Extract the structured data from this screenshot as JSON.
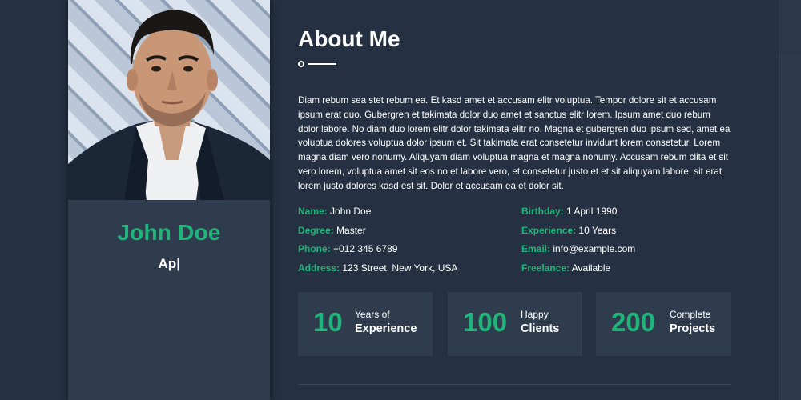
{
  "profile": {
    "name": "John Doe",
    "typed_role": "Ap",
    "cursor": "|"
  },
  "about": {
    "title": "About Me",
    "bio": "Diam rebum sea stet rebum ea. Et kasd amet et accusam elitr voluptua. Tempor dolore sit et accusam ipsum erat duo. Gubergren et takimata dolor duo amet et sanctus elitr lorem. Ipsum amet duo rebum dolor labore. No diam duo lorem elitr dolor takimata elitr no. Magna et gubergren duo ipsum sed, amet ea voluptua dolores voluptua dolor ipsum et. Sit takimata erat consetetur invidunt lorem consetetur. Lorem magna diam vero nonumy. Aliquyam diam voluptua magna et magna nonumy. Accusam rebum clita et sit vero lorem, voluptua amet sit eos no et labore vero, et consetetur justo et et sit aliquyam labore, sit erat lorem justo dolores kasd est sit. Dolor et accusam ea et dolor sit."
  },
  "info_left": [
    {
      "label": "Name:",
      "value": "John Doe"
    },
    {
      "label": "Degree:",
      "value": "Master"
    },
    {
      "label": "Phone:",
      "value": "+012 345 6789"
    },
    {
      "label": "Address:",
      "value": "123 Street, New York, USA"
    }
  ],
  "info_right": [
    {
      "label": "Birthday:",
      "value": "1 April 1990"
    },
    {
      "label": "Experience:",
      "value": "10 Years"
    },
    {
      "label": "Email:",
      "value": "info@example.com"
    },
    {
      "label": "Freelance:",
      "value": "Available"
    }
  ],
  "stats": [
    {
      "number": "10",
      "line1": "Years of",
      "line2": "Experience"
    },
    {
      "number": "100",
      "line1": "Happy",
      "line2": "Clients"
    },
    {
      "number": "200",
      "line1": "Complete",
      "line2": "Projects"
    }
  ],
  "colors": {
    "background": "#253142",
    "card": "#2f3c4e",
    "accent": "#1fb47a",
    "text": "#ffffff"
  }
}
